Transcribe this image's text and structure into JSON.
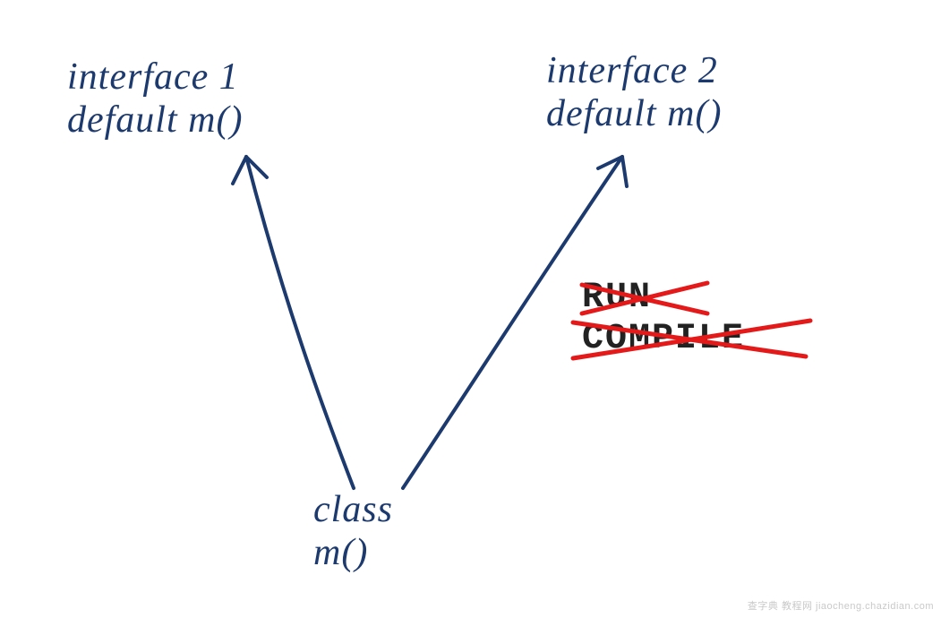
{
  "diagram": {
    "interface1": {
      "title": "interface 1",
      "method": "default m()"
    },
    "interface2": {
      "title": "interface 2",
      "method": "default m()"
    },
    "clazz": {
      "title": "class",
      "method": "m()"
    },
    "status": {
      "line1": "RUN",
      "line2": "COMPILE"
    },
    "colors": {
      "ink": "#1d3a6e",
      "cross": "#e41a1a",
      "stamp": "#222222"
    }
  },
  "watermark": "查字典 教程网  jiaocheng.chazidian.com"
}
